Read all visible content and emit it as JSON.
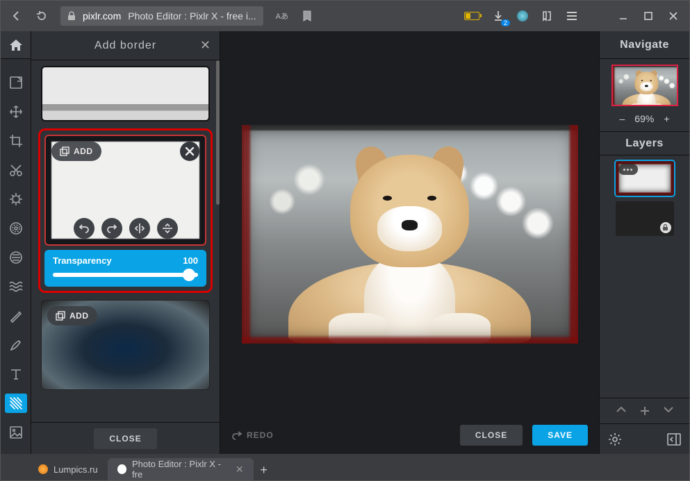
{
  "browser": {
    "url_host": "pixlr.com",
    "page_title": "Photo Editor : Pixlr X - free i...",
    "download_badge": "2"
  },
  "panel": {
    "title": "Add border",
    "add_label": "ADD",
    "transparency_label": "Transparency",
    "transparency_value": "100",
    "close_label": "CLOSE"
  },
  "actions": {
    "redo": "REDO",
    "close": "CLOSE",
    "save": "SAVE"
  },
  "right": {
    "navigate": "Navigate",
    "zoom_minus": "–",
    "zoom_value": "69%",
    "zoom_plus": "+",
    "layers": "Layers"
  },
  "tabs": {
    "t1": "Lumpics.ru",
    "t2": "Photo Editor : Pixlr X - fre"
  }
}
